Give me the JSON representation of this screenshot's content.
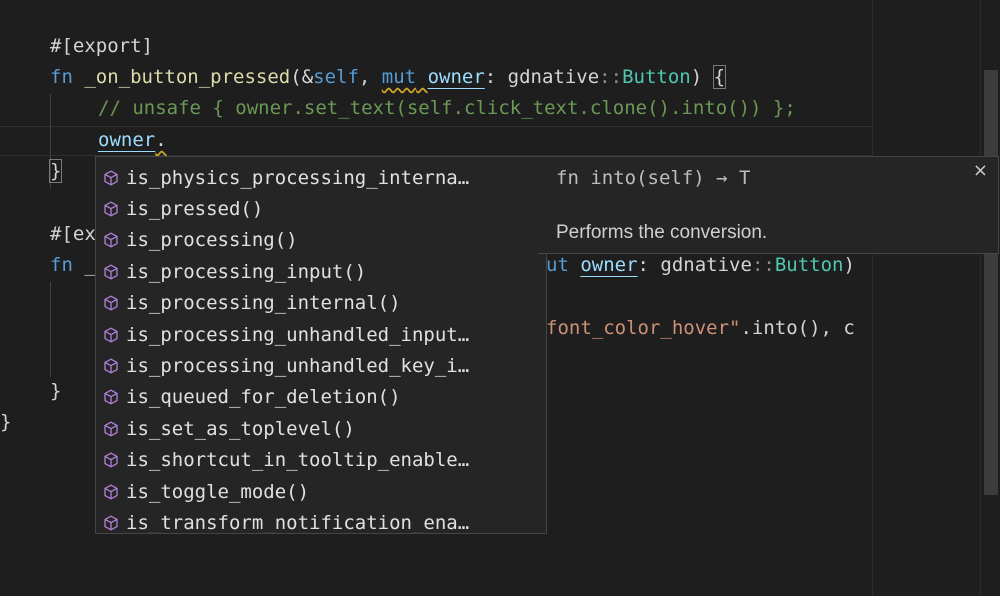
{
  "code": {
    "l1": {
      "hash": "#[",
      "attr": "export",
      "close": "]"
    },
    "l2": {
      "kw_fn": "fn",
      "name": "_on_button_pressed",
      "open": "(&",
      "self_kw": "self",
      "sep1": ", ",
      "mut_kw": "mut",
      "owner": "owner",
      "colon": ": gdnative",
      "path": "::",
      "type": "Button",
      "close": ") ",
      "brace": "{"
    },
    "l3": {
      "comment": "// unsafe { owner.set_text(self.click_text.clone().into()) };"
    },
    "l4": {
      "ident": "owner",
      "dot": "."
    },
    "l5": {
      "brace": "}"
    },
    "l7": {
      "hash": "#[",
      "attr_part": "ex"
    },
    "l8": {
      "kw_fn": "fn",
      "rest": " _",
      "tail_kw": "ut",
      "space": " ",
      "owner": "owner",
      "colon": ": gdnative",
      "path": "::",
      "type": "Button",
      "close": ")"
    },
    "l10": {
      "str": "font_color_hover\"",
      "rest": ".into(), c"
    },
    "l12": {
      "brace": "}"
    },
    "l13": {
      "brace": "}"
    }
  },
  "suggestions": [
    "is_physics_processing_interna…",
    "is_pressed()",
    "is_processing()",
    "is_processing_input()",
    "is_processing_internal()",
    "is_processing_unhandled_input…",
    "is_processing_unhandled_key_i…",
    "is_queued_for_deletion()",
    "is_set_as_toplevel()",
    "is_shortcut_in_tooltip_enable…",
    "is_toggle_mode()",
    "is_transform_notification_ena…"
  ],
  "details": {
    "signature": "fn into(self) → T",
    "doc": "Performs the conversion.",
    "close": "×"
  },
  "icons": {
    "suggestion_kind": "method-cube-icon",
    "color": "#b180d7"
  }
}
